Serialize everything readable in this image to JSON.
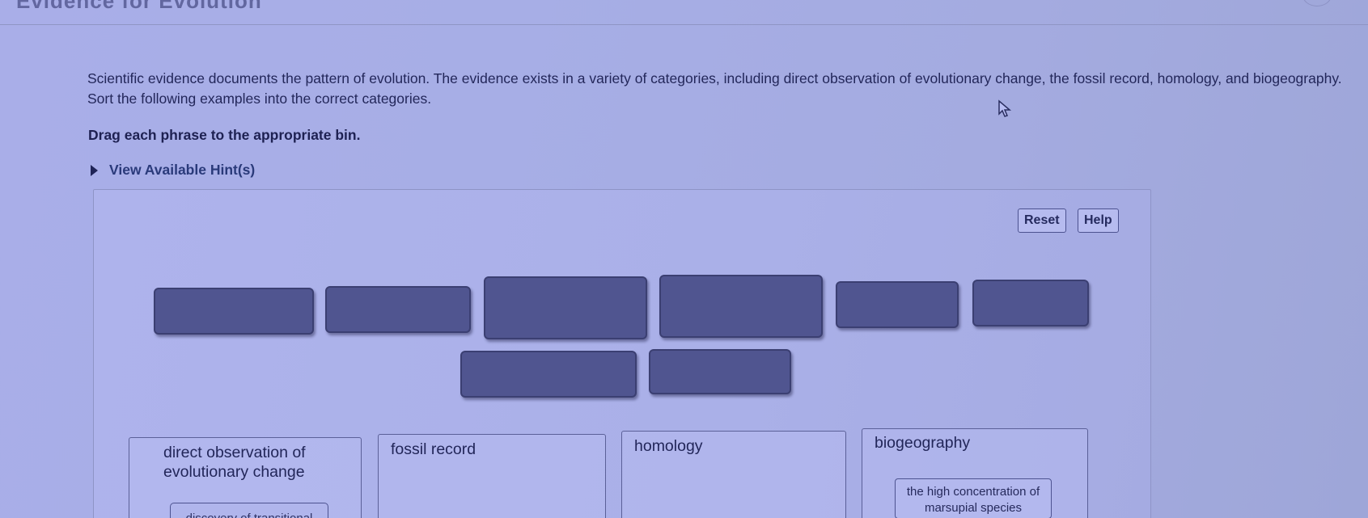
{
  "page": {
    "title": "Evidence for Evolution",
    "intro": "Scientific evidence documents the pattern of evolution. The evidence exists in a variety of categories, including direct observation of evolutionary change, the fossil record, homology, and biogeography. Sort the following examples into the correct categories.",
    "instruction": "Drag each phrase to the appropriate bin.",
    "hint_label": "View Available Hint(s)"
  },
  "toolbar": {
    "reset_label": "Reset",
    "help_label": "Help"
  },
  "bins": [
    {
      "label": "direct observation of evolutionary change",
      "items": [
        "discovery of transitional"
      ]
    },
    {
      "label": "fossil record",
      "items": []
    },
    {
      "label": "homology",
      "items": []
    },
    {
      "label": "biogeography",
      "items": [
        "the high concentration of marsupial species"
      ]
    }
  ],
  "colors": {
    "background": "#a9aee8",
    "tile": "#505590",
    "text": "#23275a"
  },
  "icons": [
    "pointer-cursor-icon",
    "expand-triangle-icon"
  ]
}
